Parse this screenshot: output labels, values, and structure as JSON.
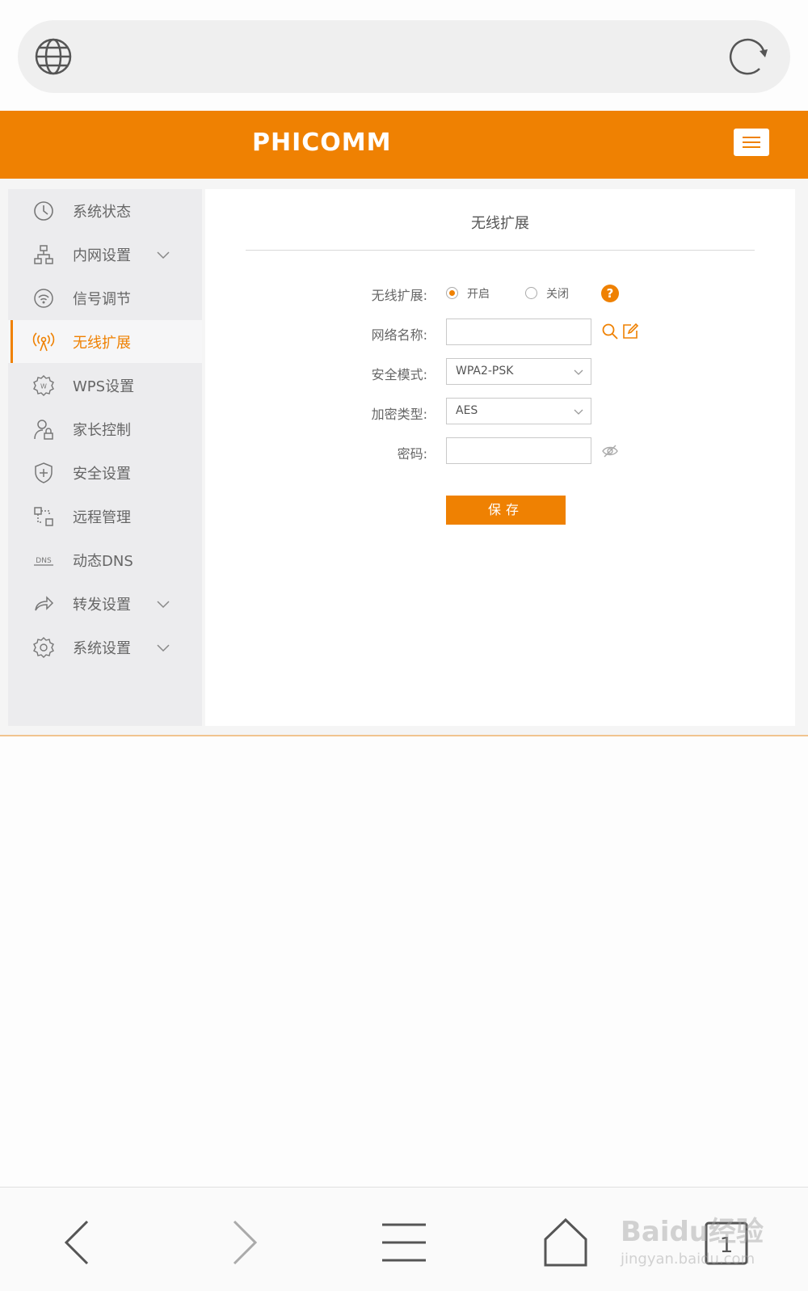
{
  "browser": {
    "address_text": "",
    "icons": {
      "left": "globe-icon",
      "right": "reload-icon"
    }
  },
  "header": {
    "logo": "PHICOMM",
    "brand_color": "#ef8102",
    "menu_icon": "hamburger-icon"
  },
  "sidebar": {
    "items": [
      {
        "label": "系统状态",
        "icon": "clock-icon",
        "expandable": false,
        "active": false
      },
      {
        "label": "内网设置",
        "icon": "network-icon",
        "expandable": true,
        "active": false
      },
      {
        "label": "信号调节",
        "icon": "signal-icon",
        "expandable": false,
        "active": false
      },
      {
        "label": "无线扩展",
        "icon": "antenna-icon",
        "expandable": false,
        "active": true
      },
      {
        "label": "WPS设置",
        "icon": "wps-gear-icon",
        "expandable": false,
        "active": false
      },
      {
        "label": "家长控制",
        "icon": "parent-lock-icon",
        "expandable": false,
        "active": false
      },
      {
        "label": "安全设置",
        "icon": "shield-icon",
        "expandable": false,
        "active": false
      },
      {
        "label": "远程管理",
        "icon": "remote-icon",
        "expandable": false,
        "active": false
      },
      {
        "label": "动态DNS",
        "icon": "dns-icon",
        "expandable": false,
        "active": false
      },
      {
        "label": "转发设置",
        "icon": "forward-icon",
        "expandable": true,
        "active": false
      },
      {
        "label": "系统设置",
        "icon": "settings-gear-icon",
        "expandable": true,
        "active": false
      }
    ]
  },
  "content": {
    "title": "无线扩展",
    "form": {
      "extend_label": "无线扩展:",
      "radio_on_label": "开启",
      "radio_off_label": "关闭",
      "radio_selected": "开启",
      "help_symbol": "?",
      "ssid_label": "网络名称:",
      "ssid_value": "",
      "security_label": "安全模式:",
      "security_value": "WPA2-PSK",
      "encryption_label": "加密类型:",
      "encryption_value": "AES",
      "password_label": "密码:",
      "password_value": "",
      "save_label": "保存"
    }
  },
  "bottom_toolbar": {
    "icons": [
      "back-icon",
      "forward-icon",
      "menu-icon",
      "home-icon",
      "tabs-icon"
    ],
    "tab_count": "1"
  },
  "watermark": {
    "text": "Baidu经验",
    "sub": "jingyan.baidu.com"
  }
}
